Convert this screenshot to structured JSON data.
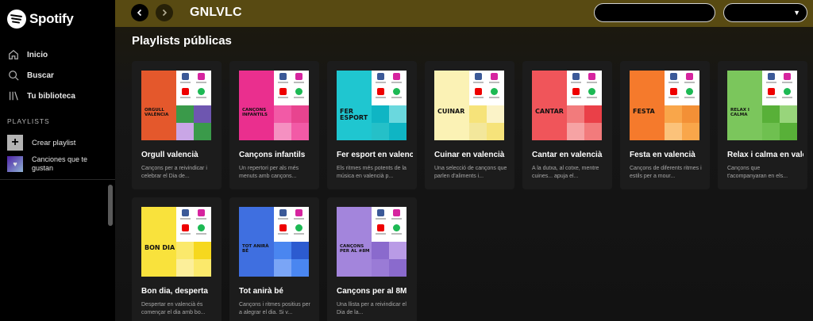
{
  "app": {
    "brand": "Spotify"
  },
  "sidebar": {
    "nav": [
      {
        "label": "Inicio",
        "icon": "home-icon"
      },
      {
        "label": "Buscar",
        "icon": "search-icon"
      },
      {
        "label": "Tu biblioteca",
        "icon": "library-icon"
      }
    ],
    "section_label": "PLAYLISTS",
    "create_playlist": "Crear playlist",
    "liked_songs": "Canciones que te gustan"
  },
  "header": {
    "title": "GNLVLC"
  },
  "section": {
    "title": "Playlists públicas"
  },
  "playlists": [
    {
      "title": "Orgull valencià",
      "desc": "Cançons per a reivindicar i celebrar el Dia de...",
      "cover_text": "ORGULL VALÈNCIA",
      "colors": [
        "#e4582c",
        "#3a9a4a",
        "#6e56b0",
        "#c9a6e6"
      ]
    },
    {
      "title": "Cançons infantils",
      "desc": "Un repertori per als més menuts amb cançons...",
      "cover_text": "CANÇONS INFANTILS",
      "colors": [
        "#ea2f8e",
        "#f25aa6",
        "#e8448f",
        "#f590c1"
      ]
    },
    {
      "title": "Fer esport en valencià",
      "desc": "Els ritmes més potents de la música en valencià p...",
      "cover_text": "FER ESPORT",
      "colors": [
        "#1fc6d0",
        "#0fb5c4",
        "#6ad8de",
        "#25c0c8"
      ]
    },
    {
      "title": "Cuinar en valencià",
      "desc": "Una selecció de cançons que parlen d'aliments i...",
      "cover_text": "CUINAR",
      "colors": [
        "#fbf2b5",
        "#f6e37a",
        "#fbf3c8",
        "#f3e79b"
      ]
    },
    {
      "title": "Cantar en valencià",
      "desc": "A la dutxa, al cotxe, mentre cuines... apuja el...",
      "cover_text": "CANTAR",
      "colors": [
        "#f0555a",
        "#f27b7c",
        "#ea4048",
        "#f6a3a4"
      ]
    },
    {
      "title": "Festa en valencià",
      "desc": "Cançons de diferents ritmes i estils per a mour...",
      "cover_text": "FESTA",
      "colors": [
        "#f57a2c",
        "#f9a64a",
        "#f39036",
        "#fbc27a"
      ]
    },
    {
      "title": "Relax i calma en valencià",
      "desc": "Cançons que t'acompanyaran en els...",
      "cover_text": "RELAX I CALMA",
      "colors": [
        "#7bc65c",
        "#58b038",
        "#98d57b",
        "#6fc050"
      ]
    },
    {
      "title": "Bon dia, desperta",
      "desc": "Despertar en valencià és començar el dia amb bo...",
      "cover_text": "BON DIA",
      "colors": [
        "#f9e23c",
        "#fbe96b",
        "#f6d81e",
        "#fcef9a"
      ]
    },
    {
      "title": "Tot anirà bé",
      "desc": "Cançons i ritmes positius per a alegrar el dia. Si v...",
      "cover_text": "TOT ANIRÀ BÉ",
      "colors": [
        "#3f6fe0",
        "#4a86f0",
        "#2c5bd0",
        "#7aa5f6"
      ]
    },
    {
      "title": "Cançons per al 8M",
      "desc": "Una llista per a reivindicar el Dia de la...",
      "cover_text": "CANÇONS PER AL #8M",
      "colors": [
        "#a385dc",
        "#8a6acd",
        "#b99be6",
        "#9a7bd6"
      ]
    }
  ]
}
